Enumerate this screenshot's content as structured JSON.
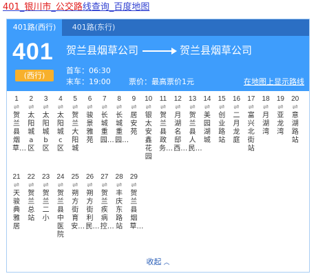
{
  "page_title": {
    "part1": "401",
    "sep1": "_",
    "part2": "银川市",
    "sep2": "_",
    "part3": "公交路",
    "part4": "线查询_百度地图"
  },
  "tabs": [
    {
      "label": "401路(西行)",
      "active": true
    },
    {
      "label": "401路(东行)",
      "active": false
    }
  ],
  "route": {
    "number": "401",
    "direction": "(西行)",
    "from": "贺兰县烟草公司",
    "to": "贺兰县烟草公司",
    "first_bus": "首车：06:30",
    "last_bus": "末车：19:00",
    "fare": "票价：最高票价1元",
    "map_link": "在地图上显示路线"
  },
  "stops": [
    {
      "num": "1",
      "name": "贺兰县烟草…"
    },
    {
      "num": "2",
      "name": "太阳城a区"
    },
    {
      "num": "3",
      "name": "太阳城b区"
    },
    {
      "num": "4",
      "name": "太阳城c区"
    },
    {
      "num": "5",
      "name": "贺兰大阳城"
    },
    {
      "num": "6",
      "name": "骏景雅苑"
    },
    {
      "num": "7",
      "name": "长城重园…"
    },
    {
      "num": "8",
      "name": "长城重园…"
    },
    {
      "num": "9",
      "name": "居安苑"
    },
    {
      "num": "10",
      "name": "银太安鑫花园"
    },
    {
      "num": "11",
      "name": "贺兰县政务…"
    },
    {
      "num": "12",
      "name": "月湖名邸西…"
    },
    {
      "num": "13",
      "name": "贺兰县人民…"
    },
    {
      "num": "14",
      "name": "美园湖城"
    },
    {
      "num": "15",
      "name": "创业路站"
    },
    {
      "num": "16",
      "name": "二月龙庭"
    },
    {
      "num": "17",
      "name": "富兴北街站"
    },
    {
      "num": "18",
      "name": "月湖湾"
    },
    {
      "num": "19",
      "name": "亚龙湾"
    },
    {
      "num": "20",
      "name": "意湖路站"
    },
    {
      "num": "21",
      "name": "天骏典雅居"
    },
    {
      "num": "22",
      "name": "贺兰总站"
    },
    {
      "num": "23",
      "name": "贺兰二小"
    },
    {
      "num": "24",
      "name": "贺兰县中医院"
    },
    {
      "num": "25",
      "name": "朔方街育安…"
    },
    {
      "num": "26",
      "name": "朔方街利民…"
    },
    {
      "num": "27",
      "name": "贺兰疾病控…"
    },
    {
      "num": "28",
      "name": "丰庆东路站"
    },
    {
      "num": "29",
      "name": "贺兰县烟草…"
    }
  ],
  "collapse_label": "收起",
  "colors": {
    "header_bg": "#3e9dfc",
    "tabbar_bg": "#2b6fc4",
    "badge_bg": "#f7b02c",
    "title_red": "#e01b1b",
    "link_blue": "#2f3fd0"
  },
  "icons": {
    "stop_icon": "transfer-arrows-icon",
    "collapse_icon": "chevron-up-icon",
    "route_arrow": "arrow-right-icon"
  }
}
